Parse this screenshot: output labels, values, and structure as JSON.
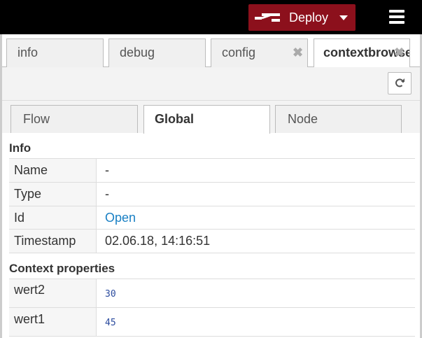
{
  "header": {
    "deploy_label": "Deploy",
    "deploy_color": "#8c101c",
    "deploy_icon": "deploy-flow-icon",
    "menu_icon": "hamburger-menu-icon"
  },
  "sidebar": {
    "tabs": [
      {
        "label": "info",
        "active": false,
        "closable": false
      },
      {
        "label": "debug",
        "active": false,
        "closable": false
      },
      {
        "label": "config",
        "active": false,
        "closable": true
      },
      {
        "label": "contextbrowser",
        "active": true,
        "closable": true
      }
    ],
    "close_glyph": "✖",
    "refresh_icon": "refresh-icon"
  },
  "scope_tabs": [
    {
      "label": "Flow",
      "active": false
    },
    {
      "label": "Global",
      "active": true
    },
    {
      "label": "Node",
      "active": false
    }
  ],
  "info": {
    "title": "Info",
    "rows": [
      {
        "key": "Name",
        "value": "-"
      },
      {
        "key": "Type",
        "value": "-"
      },
      {
        "key": "Id",
        "value": "Open"
      },
      {
        "key": "Timestamp",
        "value": "02.06.18, 14:16:51"
      }
    ]
  },
  "context": {
    "title": "Context properties",
    "rows": [
      {
        "key": "wert2",
        "value": "30"
      },
      {
        "key": "wert1",
        "value": "45"
      }
    ]
  }
}
